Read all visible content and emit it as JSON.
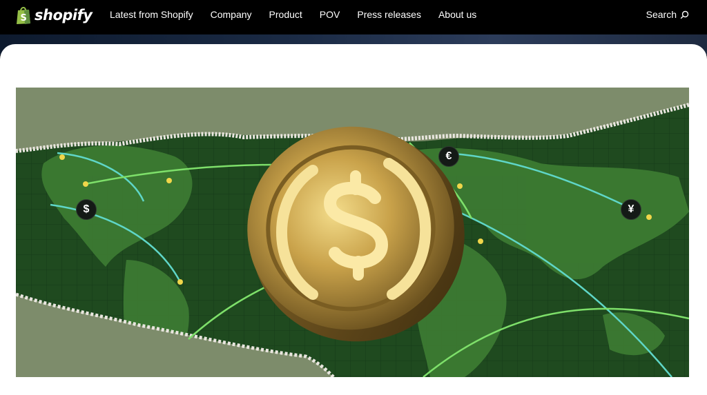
{
  "brand": {
    "name": "shopify",
    "logo_icon": "shopping-bag-icon",
    "color": "#95bf47"
  },
  "nav": {
    "items": [
      {
        "label": "Latest from Shopify"
      },
      {
        "label": "Company"
      },
      {
        "label": "Product"
      },
      {
        "label": "POV"
      },
      {
        "label": "Press releases"
      },
      {
        "label": "About us"
      }
    ],
    "search_label": "Search",
    "search_icon": "search-icon"
  },
  "hero": {
    "image_description_icons": [
      "usdc-coin-icon",
      "world-map"
    ],
    "currency_badges": [
      {
        "symbol": "$"
      },
      {
        "symbol": "€"
      },
      {
        "symbol": "¥"
      }
    ],
    "colors": {
      "map_green": "#2f6b2a",
      "paper": "#7d8c6b",
      "coin_gold": "#c9a24a",
      "route": "#7ee06a"
    }
  }
}
